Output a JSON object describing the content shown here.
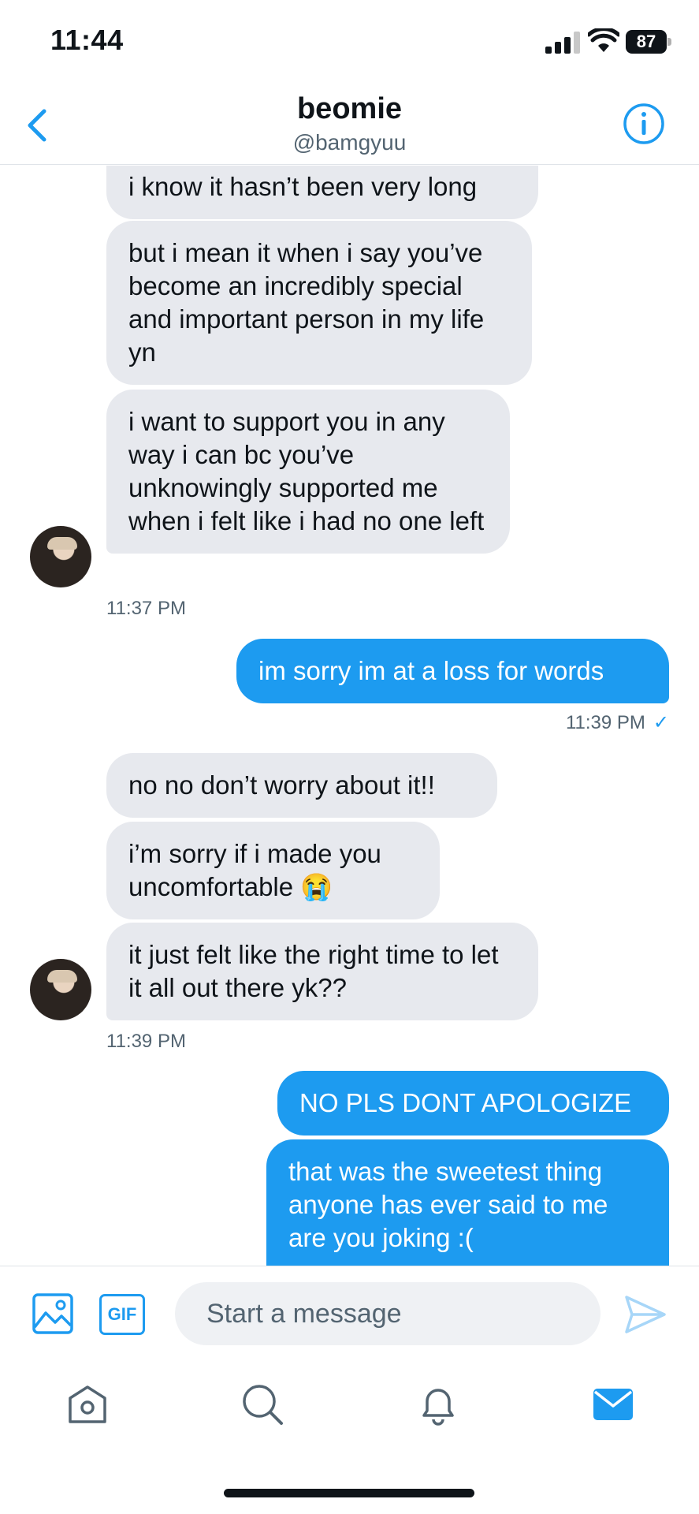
{
  "status_bar": {
    "time": "11:44",
    "battery": "87"
  },
  "header": {
    "name": "beomie",
    "handle": "@bamgyuu"
  },
  "messages": {
    "m1": "i know it hasn’t been very long",
    "m2": "but i mean it when i say you’ve become an incredibly special and important person in my life yn",
    "m3": "i want to support you in any way i can bc you’ve unknowingly supported me when i felt like i had no one left",
    "t1": "11:37 PM",
    "m4": "im sorry im at a loss for words",
    "t2": "11:39 PM",
    "m5": "no no don’t worry about it!!",
    "m6": "i’m sorry if i made you uncomfortable 😭",
    "m7": "it just felt like the right time to let it all out there yk??",
    "t3": "11:39 PM",
    "m8": "NO PLS DONT APOLOGIZE",
    "m9": "that was the sweetest thing anyone has ever said to me are you joking :("
  },
  "composer": {
    "placeholder": "Start a message",
    "gif_label": "GIF"
  },
  "colors": {
    "accent": "#1d9bf0",
    "incoming_bubble": "#e7e9ee",
    "secondary_text": "#536471"
  },
  "icons": [
    "back-icon",
    "info-icon",
    "media-icon",
    "gif-icon",
    "send-icon",
    "home-icon",
    "search-icon",
    "bell-icon",
    "mail-icon"
  ]
}
